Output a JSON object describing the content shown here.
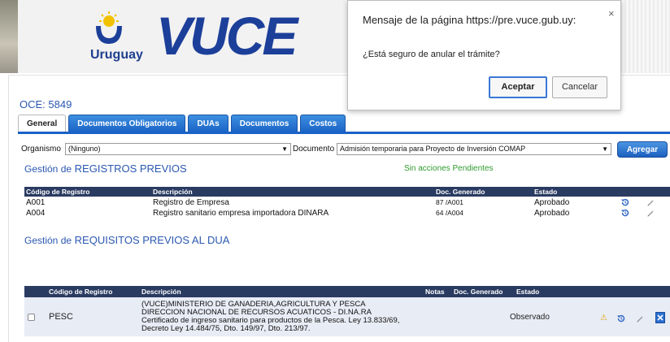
{
  "header": {
    "country": "Uruguay",
    "brand": "VUCE"
  },
  "oce_label": "OCE: 5849",
  "tabs": [
    {
      "label": "General",
      "active": true
    },
    {
      "label": "Documentos Obligatorios"
    },
    {
      "label": "DUAs"
    },
    {
      "label": "Documentos"
    },
    {
      "label": "Costos"
    }
  ],
  "filters": {
    "organismo_label": "Organismo",
    "organismo_value": "(Ninguno)",
    "documento_label": "Documento",
    "documento_value": "Admisión temporaria para Proyecto de Inversión COMAP",
    "agregar_label": "Agregar"
  },
  "registros": {
    "title_prefix": "Gestión de",
    "title_main": "REGISTROS PREVIOS",
    "pending_text": "Sin acciones Pendientes",
    "headers": [
      "Código de Registro",
      "Descripción",
      "Doc. Generado",
      "Estado"
    ],
    "rows": [
      {
        "codigo": "A001",
        "descripcion": "Registro de Empresa",
        "doc": "87 /A001",
        "estado": "Aprobado"
      },
      {
        "codigo": "A004",
        "descripcion": "Registro sanitario empresa importadora DINARA",
        "doc": "64 /A004",
        "estado": "Aprobado"
      }
    ]
  },
  "requisitos": {
    "title_prefix": "Gestión de",
    "title_main": "REQUISITOS PREVIOS AL DUA",
    "headers": [
      "Código de Registro",
      "Descripción",
      "Notas",
      "Doc. Generado",
      "Estado"
    ],
    "row": {
      "codigo": "PESC",
      "desc_lines": [
        "(VUCE)MINISTERIO DE GANADERIA,AGRICULTURA Y PESCA",
        "DIRECCION NACIONAL DE RECURSOS ACUATICOS - DI.NA.RA",
        "Certificado de ingreso sanitario para productos de la Pesca. Ley 13.833/69,",
        "Decreto Ley 14.484/75, Dto. 149/97, Dto. 213/97."
      ],
      "estado": "Observado",
      "warning_icon": "⚠"
    }
  },
  "dialog": {
    "title": "Mensaje de la página https://pre.vuce.gub.uy:",
    "close": "×",
    "message": "¿Está seguro de anular el trámite?",
    "ok_label": "Aceptar",
    "cancel_label": "Cancelar"
  },
  "colors": {
    "brand_blue": "#1c3f9a",
    "link_blue": "#2b58b0",
    "header_navy": "#2a3b61",
    "tab_blue": "#1a62c6",
    "ok_green": "#2f9a2f"
  }
}
